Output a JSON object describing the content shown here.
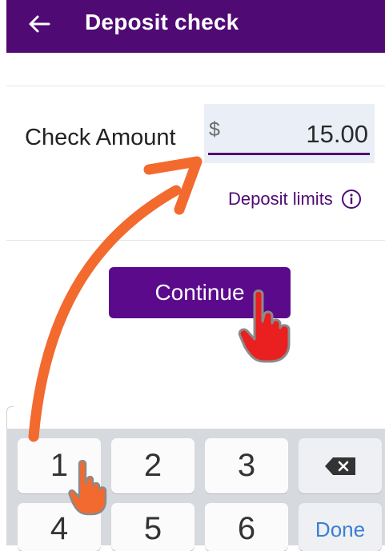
{
  "header": {
    "title": "Deposit check"
  },
  "form": {
    "amount_label": "Check Amount",
    "currency_symbol": "$",
    "amount_value": "15.00",
    "deposit_limits": "Deposit limits"
  },
  "actions": {
    "continue_label": "Continue"
  },
  "keyboard": {
    "keys": [
      "1",
      "2",
      "3",
      "4",
      "5",
      "6"
    ],
    "done_label": "Done"
  },
  "colors": {
    "brand_purple": "#4f0a73",
    "button_purple": "#5b0a8c",
    "annotation_orange": "#f26a2e",
    "hand_red": "#ea1f1f",
    "done_blue": "#3b7fd0"
  }
}
